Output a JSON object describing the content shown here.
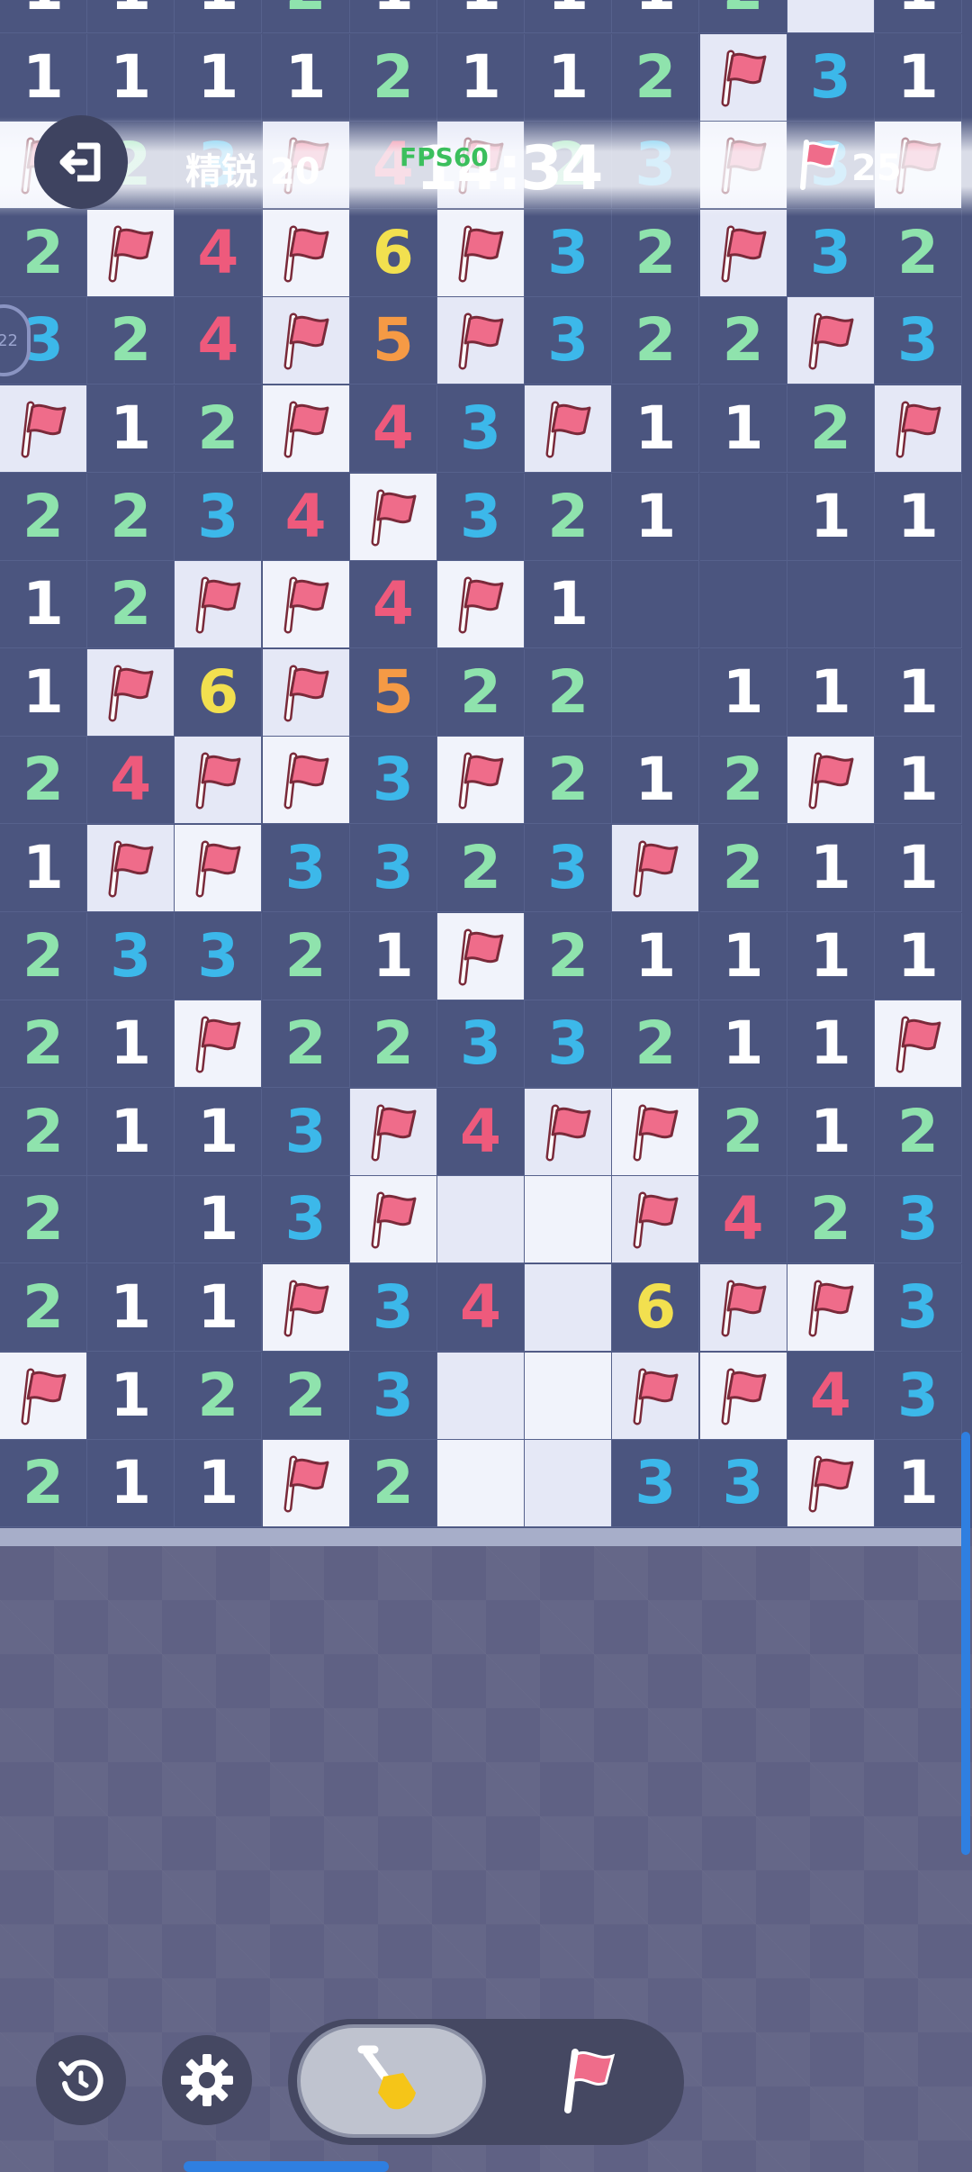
{
  "header": {
    "difficulty": "精锐 20",
    "timer": "14:34",
    "fps_overlay": "FPS60",
    "flags_remaining": "25",
    "side_badge": "22"
  },
  "board": {
    "rows": [
      [
        "1",
        "1",
        "1",
        "2",
        "1",
        "1",
        "1",
        "1",
        "2",
        "L",
        "1"
      ],
      [
        "1",
        "1",
        "1",
        "1",
        "2",
        "1",
        "1",
        "2",
        "F",
        "3",
        "1"
      ],
      [
        "F",
        "2",
        "3",
        "F",
        "4",
        "F",
        "2",
        "3",
        "F",
        "3",
        "F"
      ],
      [
        "2",
        "F",
        "4",
        "F",
        "6",
        "F",
        "3",
        "2",
        "F",
        "3",
        "2"
      ],
      [
        "3",
        "2",
        "4",
        "F",
        "5",
        "F",
        "3",
        "2",
        "2",
        "F",
        "3"
      ],
      [
        "F",
        "1",
        "2",
        "F",
        "4",
        "3",
        "F",
        "1",
        "1",
        "2",
        "F"
      ],
      [
        "2",
        "2",
        "3",
        "4",
        "F",
        "3",
        "2",
        "1",
        "",
        "1",
        "1"
      ],
      [
        "1",
        "2",
        "F",
        "F",
        "4",
        "F",
        "1",
        "",
        "",
        "",
        ""
      ],
      [
        "1",
        "F",
        "6",
        "F",
        "5",
        "2",
        "2",
        "",
        "1",
        "1",
        "1"
      ],
      [
        "2",
        "4",
        "F",
        "F",
        "3",
        "F",
        "2",
        "1",
        "2",
        "F",
        "1"
      ],
      [
        "1",
        "F",
        "F",
        "3",
        "3",
        "2",
        "3",
        "F",
        "2",
        "1",
        "1"
      ],
      [
        "2",
        "3",
        "3",
        "2",
        "1",
        "F",
        "2",
        "1",
        "1",
        "1",
        "1"
      ],
      [
        "2",
        "1",
        "F",
        "2",
        "2",
        "3",
        "3",
        "2",
        "1",
        "1",
        "F"
      ],
      [
        "2",
        "1",
        "1",
        "3",
        "F",
        "4",
        "F",
        "F",
        "2",
        "1",
        "2"
      ],
      [
        "2",
        "",
        "1",
        "3",
        "F",
        "L",
        "L",
        "F",
        "4",
        "2",
        "3"
      ],
      [
        "2",
        "1",
        "1",
        "F",
        "3",
        "4",
        "L",
        "6",
        "F",
        "F",
        "3"
      ],
      [
        "F",
        "1",
        "2",
        "2",
        "3",
        "L",
        "L",
        "F",
        "F",
        "4",
        "3"
      ],
      [
        "2",
        "1",
        "1",
        "F",
        "2",
        "L",
        "L",
        "3",
        "3",
        "F",
        "1"
      ]
    ]
  },
  "colors": {
    "1": "#ffffff",
    "2": "#8fe3ad",
    "3": "#3cb8ea",
    "4": "#ee5a7c",
    "5": "#f59a45",
    "6": "#f2e04f",
    "flag": "#ef6c8a",
    "board": "#4b557f",
    "revealed_light": "#f1f3fb"
  },
  "icons": {
    "exit": "exit-door-icon",
    "flag": "flag-icon",
    "undo": "undo-icon",
    "settings": "gear-icon",
    "dig": "shovel-icon"
  },
  "controls": {
    "active_mode": "dig"
  }
}
